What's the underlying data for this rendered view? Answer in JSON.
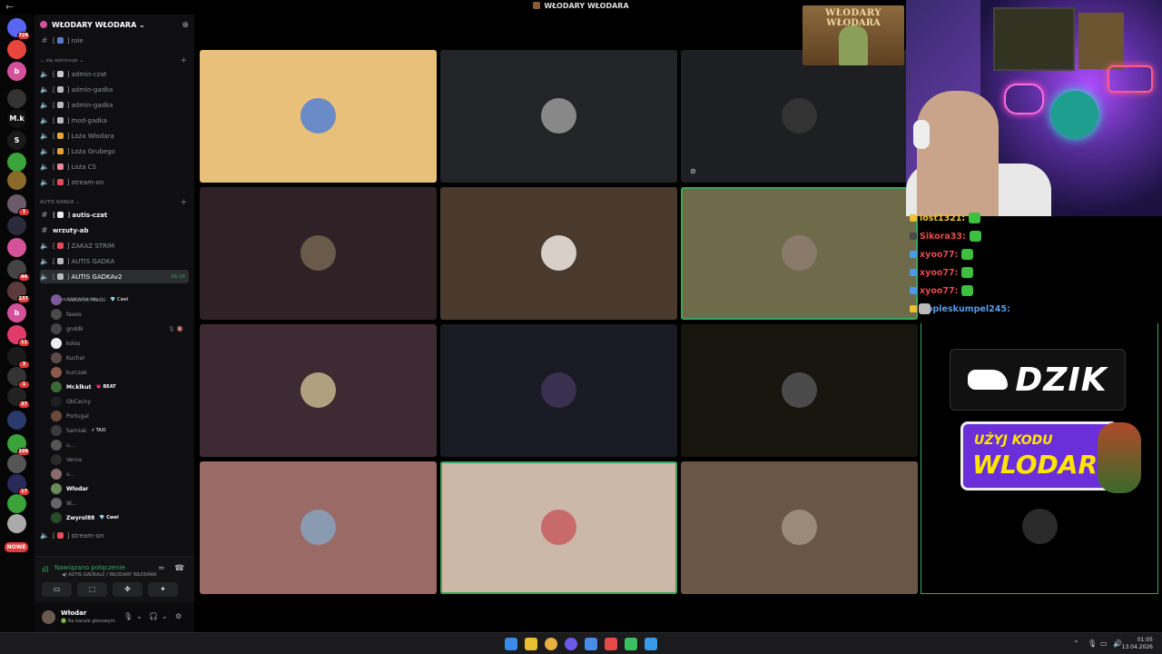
{
  "window": {
    "title": "WŁODARY WŁODARA",
    "back_glyph": "←"
  },
  "rail": {
    "servers": [
      {
        "label": "",
        "color": "#5865f2",
        "badge": "729",
        "icon": "discord-icon"
      },
      {
        "label": "",
        "color": "#e8453c",
        "badge": "",
        "icon": "server-avatar"
      },
      {
        "label": "b",
        "color": "#d4529a",
        "badge": "",
        "icon": "server-avatar"
      },
      {
        "label": "",
        "color": "#333",
        "badge": "",
        "icon": "server-avatar"
      },
      {
        "label": "M.k",
        "color": "#111",
        "badge": "",
        "icon": "server-avatar"
      },
      {
        "label": "S",
        "color": "#1a1a1a",
        "badge": "",
        "icon": "server-avatar"
      },
      {
        "label": "",
        "color": "#3aa33a",
        "badge": "",
        "icon": "server-avatar"
      },
      {
        "label": "",
        "color": "#8a6a2a",
        "badge": "",
        "icon": "server-avatar"
      },
      {
        "label": "",
        "color": "#6a5a6a",
        "badge": "1",
        "icon": "server-avatar"
      },
      {
        "label": "",
        "color": "#2a2a3a",
        "badge": "",
        "icon": "server-avatar"
      },
      {
        "label": "",
        "color": "#d4529a",
        "badge": "",
        "icon": "server-avatar"
      },
      {
        "label": "",
        "color": "#444",
        "badge": "44",
        "icon": "server-avatar"
      },
      {
        "label": "",
        "color": "#5a3a3a",
        "badge": "137",
        "icon": "server-avatar"
      },
      {
        "label": "b",
        "color": "#d4529a",
        "badge": "",
        "icon": "server-avatar"
      },
      {
        "label": "",
        "color": "#e23b6a",
        "badge": "11",
        "icon": "server-avatar"
      },
      {
        "label": "",
        "color": "#1a1a1a",
        "badge": "3",
        "icon": "server-avatar"
      },
      {
        "label": "",
        "color": "#333",
        "badge": "1",
        "icon": "server-avatar"
      },
      {
        "label": "",
        "color": "#222",
        "badge": "37",
        "icon": "server-avatar"
      },
      {
        "label": "",
        "color": "#2a3a6a",
        "badge": "",
        "icon": "server-avatar"
      },
      {
        "label": "",
        "color": "#3aa33a",
        "badge": "109",
        "icon": "server-avatar"
      },
      {
        "label": "",
        "color": "#555",
        "badge": "",
        "icon": "server-avatar"
      },
      {
        "label": "",
        "color": "#2a2a5a",
        "badge": "17",
        "icon": "server-avatar"
      },
      {
        "label": "",
        "color": "#3aa33a",
        "badge": "",
        "icon": "server-avatar"
      },
      {
        "label": "",
        "color": "#aaa",
        "badge": "",
        "icon": "server-avatar"
      }
    ],
    "new_label": "NOWE"
  },
  "sidebar": {
    "server_name": "WŁODARY WŁODARA ⌄",
    "channels_top": [
      {
        "name": "role",
        "glyph": "#",
        "em": "#5a7acc"
      }
    ],
    "cat1": "⌄ się adminuje ⌄",
    "cat1_channels": [
      {
        "name": "admin-czat",
        "glyph": "◀)",
        "em": "#ccc"
      },
      {
        "name": "admin-gadka",
        "glyph": "◀)",
        "em": "#bbb"
      },
      {
        "name": "admin-gadka",
        "glyph": "◀)",
        "em": "#bbb"
      },
      {
        "name": "mod-gadka",
        "glyph": "◀)",
        "em": "#bbb"
      },
      {
        "name": "Loża Włodara",
        "glyph": "◀)",
        "em": "#e8a23a"
      },
      {
        "name": "Loża Grubego",
        "glyph": "◀)",
        "em": "#e8a23a"
      },
      {
        "name": "Loża CS",
        "glyph": "◀)",
        "em": "#e88a9a"
      },
      {
        "name": "stream-on",
        "glyph": "◀)",
        "em": "#e84a5a"
      }
    ],
    "cat2": "AUTIS BANDA ⌄",
    "cat2_channels": [
      {
        "name": "autis-czat",
        "glyph": "#",
        "em": "#eee",
        "bright": true
      },
      {
        "name": "wrzuty-ab",
        "glyph": "#",
        "em": "",
        "bright": true
      },
      {
        "name": "ZAKAZ STRIM",
        "glyph": "◀)",
        "em": "#e84a5a"
      },
      {
        "name": "AUTIS GADKA",
        "glyph": "◀)",
        "em": "#bbb"
      },
      {
        "name": "AUTIS GADKAv2",
        "glyph": "◀)",
        "em": "#bbb",
        "active": true,
        "time": "26:16"
      }
    ],
    "set_status": "Ustaw status kanału ✎",
    "voice_users": [
      {
        "name": "ANKARA Messi",
        "tag": "💎 Cwel",
        "color": "#7a5a9a",
        "bright": false
      },
      {
        "name": "faxeo",
        "tag": "",
        "color": "#4a4a4a",
        "bright": false
      },
      {
        "name": "gnddk",
        "tag": "",
        "color": "#444",
        "bright": false,
        "tools": "🎙 🔇"
      },
      {
        "name": "kolos",
        "tag": "",
        "color": "#eee",
        "bright": false
      },
      {
        "name": "Kuchar",
        "tag": "",
        "color": "#5a4a4a",
        "bright": false
      },
      {
        "name": "kurczak",
        "tag": "",
        "color": "#8a5a4a",
        "bright": false
      },
      {
        "name": "Mr.klkut",
        "tag": "💗 BEAT",
        "color": "#3a6a3a",
        "bright": true
      },
      {
        "name": "ObCecny",
        "tag": "",
        "color": "#1e1f22",
        "bright": false
      },
      {
        "name": "Portugal",
        "tag": "",
        "color": "#6a4a3a",
        "bright": false
      },
      {
        "name": "Sarniak",
        "tag": "⚡ TAXI",
        "color": "#3a3a3a",
        "bright": false
      },
      {
        "name": "u...",
        "tag": "",
        "color": "#555",
        "bright": false
      },
      {
        "name": "Verva",
        "tag": "",
        "color": "#2a2a2a",
        "bright": false
      },
      {
        "name": "v...",
        "tag": "",
        "color": "#8a6a6a",
        "bright": false
      },
      {
        "name": "Włodar",
        "tag": "",
        "color": "#6a8a5a",
        "bright": true
      },
      {
        "name": "W...",
        "tag": "",
        "color": "#666",
        "bright": false
      },
      {
        "name": "Zwyrol88",
        "tag": "💎 Cwel",
        "color": "#2a4a2a",
        "bright": true
      }
    ],
    "after_channel": {
      "name": "stream-on",
      "glyph": "◀)",
      "em": "#e84a5a"
    },
    "voice_status": {
      "title": "Nawiązano połączenie",
      "sub": "◀) AUTIS GADKAv2 / WŁODARY WŁODARA"
    },
    "user": {
      "name": "Włodar",
      "status": "🟢 Na kanale głosowym"
    }
  },
  "stage": {
    "tiles": [
      {
        "bg": "#e8c07a",
        "av": "#6a8ac8",
        "hl": false
      },
      {
        "bg": "#232428",
        "av": "#888",
        "hl": false
      },
      {
        "bg": "#1e1f22",
        "av": "#333",
        "hl": false,
        "muted": true
      },
      {
        "bg": "#2e2226",
        "av": "#6a5a4a",
        "hl": false
      },
      {
        "bg": "#4a3a2e",
        "av": "#d8d0c8",
        "hl": false
      },
      {
        "bg": "#6e6a4a",
        "av": "#8a7a6a",
        "hl": true
      },
      {
        "bg": "#3e2a32",
        "av": "#b0a080",
        "hl": false
      },
      {
        "bg": "#1a1a24",
        "av": "#3a3050",
        "hl": false
      },
      {
        "bg": "#16160f",
        "av": "#4a4a4a",
        "hl": false
      },
      {
        "bg": "#9a6a66",
        "av": "#8a9ab0",
        "hl": false
      },
      {
        "bg": "#ccb8a6",
        "av": "#c86a6a",
        "hl": true
      },
      {
        "bg": "#6a5646",
        "av": "#9a8a7a",
        "hl": false
      }
    ],
    "overlay_title1": "WŁODARY",
    "overlay_title2": "WŁODARA"
  },
  "chat": [
    {
      "user": "lost1321:",
      "color": "#f0c030",
      "badge": "#f0c030"
    },
    {
      "user": "Sikora33:",
      "color": "#e84a4a",
      "badge": "#4a4a4a"
    },
    {
      "user": "xyoo77:",
      "color": "#e84a4a",
      "badge": "#4a9ae8"
    },
    {
      "user": "xyoo77:",
      "color": "#e84a4a",
      "badge": "#4a9ae8"
    },
    {
      "user": "xyoo77:",
      "color": "#e84a4a",
      "badge": "#4a9ae8"
    },
    {
      "user": "Hopleskumpel245:",
      "color": "#5a9ae8",
      "badge": "#f0c030",
      "cat": true
    }
  ],
  "ad": {
    "brand": "DZIK",
    "line1": "UŻYJ KODU",
    "line2": "WLODAR"
  },
  "taskbar": {
    "apps": [
      "#3a8ae8",
      "#e8c030",
      "#e8b040",
      "#6a5ae8",
      "#4a8ae8",
      "#e84a4a",
      "#3ac060",
      "#3a9ae8"
    ],
    "time": "01:05",
    "date": "13.04.2026"
  }
}
